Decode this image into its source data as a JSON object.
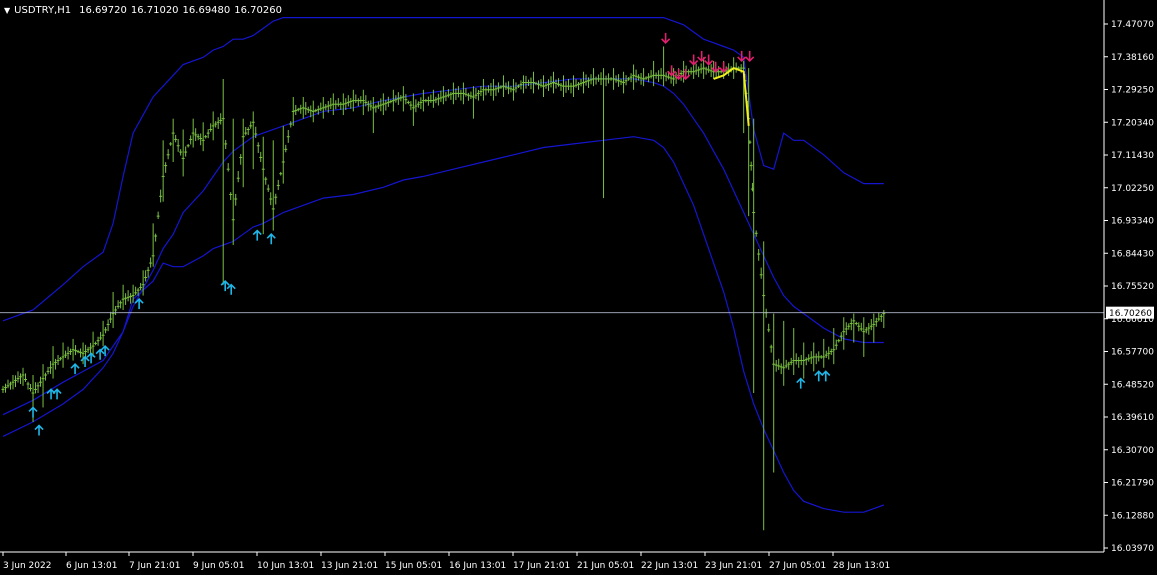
{
  "header": {
    "symbol": "USDTRY,H1",
    "open": "16.69720",
    "high": "16.71020",
    "low": "16.69480",
    "close": "16.70260",
    "menu_icon": "triangle-down-icon"
  },
  "colors": {
    "background": "#000000",
    "price_bars": "#7ac142",
    "bands": "#1515d0",
    "highlight_line": "#f0f020",
    "up_arrows": "#1fb6e8",
    "down_arrows": "#e0206e",
    "price_line": "#b0b6c8",
    "price_tag_bg": "#ffffff",
    "axis_text": "#ffffff"
  },
  "chart_data": {
    "type": "line",
    "ylim": [
      16.0397,
      17.5299
    ],
    "y_ticks": [
      "17.47070",
      "17.38160",
      "17.29250",
      "17.20340",
      "17.11430",
      "17.02250",
      "16.93340",
      "16.84430",
      "16.75520",
      "16.66610",
      "16.57700",
      "16.48520",
      "16.39610",
      "16.30700",
      "16.21790",
      "16.12880",
      "16.03970"
    ],
    "x_ticks": [
      "3 Jun 2022",
      "6 Jun 13:01",
      "7 Jun 21:01",
      "9 Jun 05:01",
      "10 Jun 13:01",
      "13 Jun 21:01",
      "15 Jun 05:01",
      "16 Jun 13:01",
      "17 Jun 21:01",
      "21 Jun 05:01",
      "22 Jun 13:01",
      "23 Jun 21:01",
      "27 Jun 05:01",
      "28 Jun 13:01"
    ],
    "current_price": "16.70260",
    "price_series": {
      "name": "USDTRY,H1",
      "x": [
        0,
        10,
        20,
        30,
        40,
        50,
        60,
        70,
        80,
        90,
        100,
        110,
        120,
        130,
        140,
        150,
        160,
        170,
        180,
        190,
        200,
        210,
        220,
        230,
        240,
        250,
        260,
        270,
        280,
        290,
        300,
        310,
        320,
        330,
        340,
        350,
        360,
        370,
        380,
        390,
        400,
        410,
        420,
        430,
        440,
        450,
        460,
        470,
        480,
        490,
        500,
        510,
        520,
        530,
        540,
        550,
        560,
        570,
        580,
        590,
        600,
        610,
        620,
        630,
        640,
        650,
        660,
        670,
        680,
        690,
        700,
        710,
        720,
        730,
        740,
        745,
        750,
        760,
        770,
        780,
        790,
        800,
        810,
        820,
        830,
        840,
        850,
        860,
        870,
        880
      ],
      "y": [
        16.49,
        16.51,
        16.53,
        16.48,
        16.52,
        16.56,
        16.58,
        16.6,
        16.59,
        16.61,
        16.64,
        16.7,
        16.74,
        16.75,
        16.78,
        16.86,
        17.08,
        17.2,
        17.13,
        17.2,
        17.18,
        17.22,
        17.24,
        16.96,
        17.19,
        17.23,
        17.1,
        16.99,
        17.12,
        17.26,
        17.27,
        17.26,
        17.27,
        17.28,
        17.28,
        17.29,
        17.29,
        17.27,
        17.28,
        17.29,
        17.3,
        17.27,
        17.29,
        17.29,
        17.3,
        17.31,
        17.31,
        17.3,
        17.32,
        17.32,
        17.33,
        17.32,
        17.34,
        17.34,
        17.33,
        17.34,
        17.33,
        17.33,
        17.34,
        17.35,
        17.35,
        17.35,
        17.34,
        17.36,
        17.35,
        17.36,
        17.36,
        17.35,
        17.37,
        17.37,
        17.38,
        17.37,
        17.37,
        17.38,
        17.38,
        17.24,
        16.98,
        16.75,
        16.56,
        16.55,
        16.57,
        16.57,
        16.58,
        16.58,
        16.6,
        16.65,
        16.68,
        16.65,
        16.67,
        16.7
      ],
      "high": [
        16.5,
        16.53,
        16.55,
        16.53,
        16.56,
        16.61,
        16.62,
        16.63,
        16.62,
        16.65,
        16.68,
        16.76,
        16.78,
        16.78,
        16.82,
        16.95,
        17.18,
        17.24,
        17.21,
        17.24,
        17.23,
        17.26,
        17.35,
        17.24,
        17.24,
        17.26,
        17.19,
        17.18,
        17.22,
        17.3,
        17.3,
        17.29,
        17.3,
        17.31,
        17.31,
        17.32,
        17.32,
        17.3,
        17.31,
        17.32,
        17.33,
        17.31,
        17.32,
        17.32,
        17.33,
        17.34,
        17.34,
        17.33,
        17.35,
        17.35,
        17.36,
        17.35,
        17.36,
        17.37,
        17.36,
        17.37,
        17.36,
        17.36,
        17.37,
        17.38,
        17.38,
        17.38,
        17.37,
        17.39,
        17.38,
        17.4,
        17.44,
        17.38,
        17.4,
        17.4,
        17.41,
        17.4,
        17.4,
        17.41,
        17.4,
        17.38,
        17.24,
        16.9,
        16.7,
        16.68,
        16.66,
        16.62,
        16.62,
        16.63,
        16.66,
        16.69,
        16.7,
        16.69,
        16.7,
        16.71
      ],
      "low": [
        16.48,
        16.49,
        16.5,
        16.4,
        16.44,
        16.52,
        16.55,
        16.57,
        16.56,
        16.58,
        16.61,
        16.66,
        16.71,
        16.73,
        16.75,
        16.83,
        17.01,
        17.12,
        17.08,
        17.16,
        17.15,
        17.18,
        16.78,
        16.89,
        17.05,
        17.1,
        16.92,
        16.93,
        17.06,
        17.22,
        17.24,
        17.23,
        17.24,
        17.25,
        17.25,
        17.26,
        17.25,
        17.2,
        17.25,
        17.26,
        17.26,
        17.22,
        17.26,
        17.27,
        17.28,
        17.28,
        17.28,
        17.24,
        17.29,
        17.29,
        17.3,
        17.29,
        17.31,
        17.31,
        17.3,
        17.31,
        17.3,
        17.3,
        17.31,
        17.33,
        17.02,
        17.32,
        17.31,
        17.32,
        17.33,
        17.33,
        17.33,
        17.33,
        17.34,
        17.35,
        17.35,
        17.35,
        17.35,
        17.35,
        17.2,
        16.97,
        16.48,
        16.1,
        16.26,
        16.5,
        16.53,
        16.52,
        16.54,
        16.55,
        16.56,
        16.6,
        16.62,
        16.58,
        16.62,
        16.66
      ]
    },
    "series": [
      {
        "name": "",
        "x": [
          0,
          30,
          60,
          80,
          100,
          110,
          120,
          130,
          150,
          170,
          180,
          200,
          210,
          220,
          230,
          240,
          250,
          260,
          270,
          280,
          300,
          320,
          350,
          380,
          400,
          420,
          450,
          480,
          510,
          540,
          570,
          600,
          630,
          650,
          660,
          670,
          680,
          690,
          700,
          710,
          720,
          730,
          740,
          750,
          760,
          770,
          780,
          790,
          800,
          820,
          840,
          860,
          880
        ],
        "y": [
          16.68,
          16.71,
          16.78,
          16.83,
          16.87,
          16.95,
          17.08,
          17.2,
          17.3,
          17.36,
          17.39,
          17.41,
          17.43,
          17.44,
          17.46,
          17.46,
          17.47,
          17.49,
          17.51,
          17.52,
          17.52,
          17.52,
          17.52,
          17.52,
          17.52,
          17.52,
          17.52,
          17.52,
          17.52,
          17.52,
          17.52,
          17.52,
          17.52,
          17.52,
          17.52,
          17.51,
          17.5,
          17.48,
          17.46,
          17.45,
          17.44,
          17.43,
          17.41,
          17.21,
          17.11,
          17.1,
          17.2,
          17.18,
          17.18,
          17.14,
          17.09,
          17.06,
          17.06
        ]
      },
      {
        "name": "",
        "x": [
          0,
          30,
          60,
          80,
          100,
          110,
          120,
          130,
          150,
          160,
          170,
          180,
          200,
          210,
          220,
          230,
          240,
          250,
          260,
          280,
          300,
          320,
          350,
          380,
          400,
          420,
          450,
          480,
          510,
          540,
          570,
          600,
          630,
          650,
          660,
          670,
          680,
          690,
          700,
          710,
          720,
          730,
          740,
          750,
          760,
          770,
          780,
          790,
          800,
          820,
          840,
          860,
          880
        ],
        "y": [
          16.42,
          16.46,
          16.51,
          16.54,
          16.57,
          16.61,
          16.65,
          16.72,
          16.82,
          16.88,
          16.92,
          16.98,
          17.04,
          17.08,
          17.12,
          17.15,
          17.17,
          17.19,
          17.2,
          17.22,
          17.24,
          17.26,
          17.27,
          17.29,
          17.3,
          17.31,
          17.32,
          17.33,
          17.33,
          17.34,
          17.35,
          17.35,
          17.35,
          17.34,
          17.33,
          17.31,
          17.28,
          17.24,
          17.2,
          17.15,
          17.1,
          17.04,
          16.98,
          16.92,
          16.86,
          16.8,
          16.75,
          16.72,
          16.7,
          16.66,
          16.63,
          16.62,
          16.62
        ]
      },
      {
        "name": "",
        "x": [
          0,
          30,
          60,
          80,
          100,
          110,
          120,
          130,
          150,
          160,
          170,
          180,
          200,
          210,
          220,
          230,
          240,
          250,
          260,
          280,
          300,
          320,
          350,
          380,
          400,
          420,
          450,
          480,
          510,
          540,
          570,
          600,
          630,
          650,
          660,
          670,
          680,
          690,
          700,
          710,
          720,
          730,
          740,
          750,
          760,
          770,
          780,
          790,
          800,
          820,
          840,
          860,
          880
        ],
        "y": [
          16.36,
          16.4,
          16.45,
          16.49,
          16.55,
          16.59,
          16.65,
          16.74,
          16.79,
          16.84,
          16.83,
          16.83,
          16.86,
          16.88,
          16.89,
          16.9,
          16.92,
          16.94,
          16.95,
          16.98,
          17.0,
          17.02,
          17.03,
          17.05,
          17.07,
          17.08,
          17.1,
          17.12,
          17.14,
          17.16,
          17.17,
          17.18,
          17.19,
          17.18,
          17.16,
          17.12,
          17.06,
          17.0,
          16.92,
          16.84,
          16.76,
          16.66,
          16.54,
          16.45,
          16.38,
          16.32,
          16.26,
          16.21,
          16.18,
          16.16,
          16.15,
          16.15,
          16.17
        ]
      }
    ],
    "highlight_segment": {
      "x": [
        710,
        720,
        730,
        740,
        745
      ],
      "y": [
        17.35,
        17.36,
        17.38,
        17.37,
        17.22
      ]
    },
    "up_arrow_signals": [
      {
        "x": 30,
        "y": 16.44
      },
      {
        "x": 36,
        "y": 16.39
      },
      {
        "x": 48,
        "y": 16.49
      },
      {
        "x": 54,
        "y": 16.49
      },
      {
        "x": 72,
        "y": 16.56
      },
      {
        "x": 82,
        "y": 16.58
      },
      {
        "x": 88,
        "y": 16.59
      },
      {
        "x": 97,
        "y": 16.6
      },
      {
        "x": 102,
        "y": 16.61
      },
      {
        "x": 136,
        "y": 16.74
      },
      {
        "x": 222,
        "y": 16.79
      },
      {
        "x": 228,
        "y": 16.78
      },
      {
        "x": 254,
        "y": 16.93
      },
      {
        "x": 268,
        "y": 16.92
      },
      {
        "x": 797,
        "y": 16.52
      },
      {
        "x": 815,
        "y": 16.54
      },
      {
        "x": 822,
        "y": 16.54
      }
    ],
    "down_arrow_signals": [
      {
        "x": 662,
        "y": 17.45
      },
      {
        "x": 668,
        "y": 17.36
      },
      {
        "x": 675,
        "y": 17.35
      },
      {
        "x": 682,
        "y": 17.35
      },
      {
        "x": 690,
        "y": 17.39
      },
      {
        "x": 698,
        "y": 17.4
      },
      {
        "x": 705,
        "y": 17.39
      },
      {
        "x": 712,
        "y": 17.37
      },
      {
        "x": 720,
        "y": 17.37
      },
      {
        "x": 738,
        "y": 17.4
      },
      {
        "x": 746,
        "y": 17.4
      }
    ]
  }
}
